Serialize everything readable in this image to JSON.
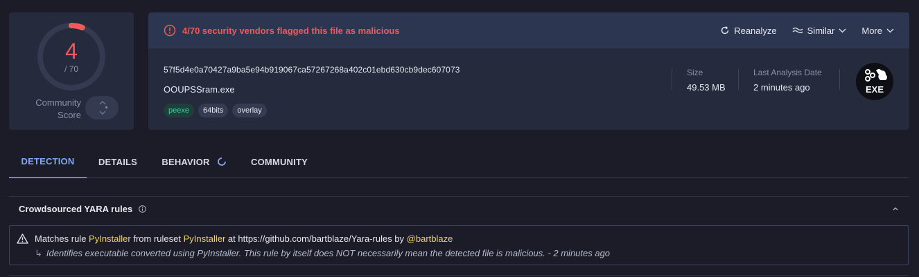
{
  "score": {
    "detections": "4",
    "total": "/ 70",
    "fraction": 0.0571,
    "community_label_line1": "Community",
    "community_label_line2": "Score",
    "ring_color": "#f05a5a"
  },
  "alert": {
    "text": "4/70 security vendors flagged this file as malicious",
    "icon": "alert-circle-icon",
    "color": "#f05a5a"
  },
  "actions": {
    "reanalyze": "Reanalyze",
    "similar": "Similar",
    "more": "More"
  },
  "file": {
    "hash": "57f5d4e0a70427a9ba5e94b919067ca57267268a402c01ebd630cb9dec607073",
    "name": "OOUPSSram.exe",
    "tags": [
      "peexe",
      "64bits",
      "overlay"
    ],
    "size_label": "Size",
    "size_value": "49.53 MB",
    "last_analysis_label": "Last Analysis Date",
    "last_analysis_value": "2 minutes ago",
    "type_icon_text": "EXE"
  },
  "tabs": [
    {
      "label": "DETECTION",
      "active": true
    },
    {
      "label": "DETAILS",
      "active": false
    },
    {
      "label": "BEHAVIOR",
      "active": false
    },
    {
      "label": "COMMUNITY",
      "active": false
    }
  ],
  "yara": {
    "title": "Crowdsourced YARA rules",
    "match_prefix": "Matches rule ",
    "rule_name": "PyInstaller",
    "from_ruleset": " from ruleset ",
    "ruleset": "PyInstaller",
    "at_text": " at https://github.com/bartblaze/Yara-rules by ",
    "author": "@bartblaze",
    "description": "Identifies executable converted using PyInstaller. This rule by itself does NOT necessarily mean the detected file is malicious. - 2 minutes ago"
  }
}
